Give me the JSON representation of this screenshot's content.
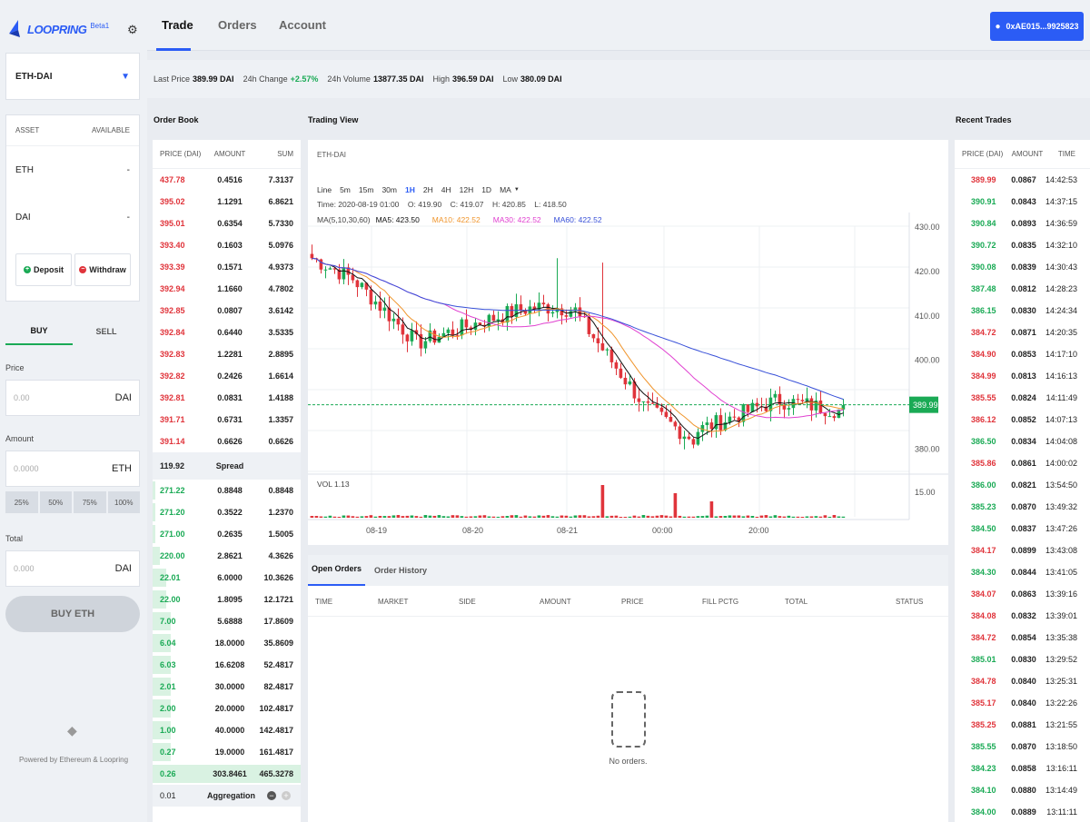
{
  "app": {
    "name": "LOOPRING",
    "badge": "Beta1"
  },
  "sidebar": {
    "market": "ETH-DAI",
    "asset_header": {
      "asset": "ASSET",
      "available": "AVAILABLE"
    },
    "assets": [
      {
        "name": "ETH",
        "value": "-"
      },
      {
        "name": "DAI",
        "value": "-"
      }
    ],
    "deposit_label": "Deposit",
    "withdraw_label": "Withdraw",
    "buy_tab": "BUY",
    "sell_tab": "SELL",
    "price_label": "Price",
    "price_placeholder": "0.00",
    "price_unit": "DAI",
    "amount_label": "Amount",
    "amount_placeholder": "0.0000",
    "amount_unit": "ETH",
    "pcts": [
      "25%",
      "50%",
      "75%",
      "100%"
    ],
    "total_label": "Total",
    "total_placeholder": "0.000",
    "total_unit": "DAI",
    "buy_button": "BUY ETH",
    "powered": "Powered by Ethereum & Loopring"
  },
  "nav": {
    "tabs": [
      "Trade",
      "Orders",
      "Account"
    ],
    "wallet": "0xAE015...9925823"
  },
  "stats": {
    "last_price_label": "Last Price",
    "last_price": "389.99 DAI",
    "change_label": "24h Change",
    "change": "+2.57%",
    "volume_label": "24h Volume",
    "volume": "13877.35 DAI",
    "high_label": "High",
    "high": "396.59 DAI",
    "low_label": "Low",
    "low": "380.09 DAI"
  },
  "orderbook": {
    "title": "Order Book",
    "headers": [
      "PRICE (DAI)",
      "AMOUNT",
      "SUM"
    ],
    "asks": [
      [
        "437.78",
        "0.4516",
        "7.3137"
      ],
      [
        "395.02",
        "1.1291",
        "6.8621"
      ],
      [
        "395.01",
        "0.6354",
        "5.7330"
      ],
      [
        "393.40",
        "0.1603",
        "5.0976"
      ],
      [
        "393.39",
        "0.1571",
        "4.9373"
      ],
      [
        "392.94",
        "1.1660",
        "4.7802"
      ],
      [
        "392.85",
        "0.0807",
        "3.6142"
      ],
      [
        "392.84",
        "0.6440",
        "3.5335"
      ],
      [
        "392.83",
        "1.2281",
        "2.8895"
      ],
      [
        "392.82",
        "0.2426",
        "1.6614"
      ],
      [
        "392.81",
        "0.0831",
        "1.4188"
      ],
      [
        "391.71",
        "0.6731",
        "1.3357"
      ],
      [
        "391.14",
        "0.6626",
        "0.6626"
      ]
    ],
    "spread_value": "119.92",
    "spread_label": "Spread",
    "bids": [
      [
        "271.22",
        "0.8848",
        "0.8848",
        0.02
      ],
      [
        "271.20",
        "0.3522",
        "1.2370",
        0.02
      ],
      [
        "271.00",
        "0.2635",
        "1.5005",
        0.02
      ],
      [
        "220.00",
        "2.8621",
        "4.3626",
        0.05
      ],
      [
        "22.01",
        "6.0000",
        "10.3626",
        0.09
      ],
      [
        "22.00",
        "1.8095",
        "12.1721",
        0.09
      ],
      [
        "7.00",
        "5.6888",
        "17.8609",
        0.12
      ],
      [
        "6.04",
        "18.0000",
        "35.8609",
        0.12
      ],
      [
        "6.03",
        "16.6208",
        "52.4817",
        0.12
      ],
      [
        "2.01",
        "30.0000",
        "82.4817",
        0.12
      ],
      [
        "2.00",
        "20.0000",
        "102.4817",
        0.12
      ],
      [
        "1.00",
        "40.0000",
        "142.4817",
        0.12
      ],
      [
        "0.27",
        "19.0000",
        "161.4817",
        0.12
      ],
      [
        "0.26",
        "303.8461",
        "465.3278",
        1.0
      ]
    ],
    "agg_value": "0.01",
    "agg_label": "Aggregation"
  },
  "trading": {
    "title": "Trading View",
    "pair": "ETH-DAI",
    "intervals": [
      "Line",
      "5m",
      "15m",
      "30m",
      "1H",
      "2H",
      "4H",
      "12H",
      "1D",
      "MA"
    ],
    "active_interval": "1H",
    "ohlc": "Time: 2020-08-19 01:00    O: 419.90    C: 419.07    H: 420.85    L: 418.50",
    "ma": {
      "label": "MA(5,10,30,60)",
      "ma5": "MA5: 423.50",
      "ma10": "MA10: 422.52",
      "ma30": "MA30: 422.52",
      "ma60": "MA60: 422.52"
    },
    "price_ticks": [
      "430.00",
      "420.00",
      "410.00",
      "400.00",
      "380.00"
    ],
    "current_price": "389.99",
    "vol_label": "VOL",
    "vol_value": "1.13",
    "vol_tick": "15.00",
    "x_ticks": [
      "08-19",
      "08-20",
      "08-21",
      "00:00",
      "20:00"
    ],
    "colors": {
      "up": "#1aaa55",
      "down": "#e0343b",
      "ma5": "#111111",
      "ma10": "#f0952c",
      "ma30": "#e040d0",
      "ma60": "#3850d8"
    }
  },
  "open_orders": {
    "tabs": [
      "Open Orders",
      "Order History"
    ],
    "headers": [
      "TIME",
      "MARKET",
      "SIDE",
      "AMOUNT",
      "PRICE",
      "FILL PCTG",
      "TOTAL",
      "STATUS"
    ],
    "empty": "No orders."
  },
  "trades": {
    "title": "Recent Trades",
    "headers": [
      "PRICE (DAI)",
      "AMOUNT",
      "TIME"
    ],
    "rows": [
      [
        "389.99",
        "0.0867",
        "14:42:53",
        "down"
      ],
      [
        "390.91",
        "0.0843",
        "14:37:15",
        "up"
      ],
      [
        "390.84",
        "0.0893",
        "14:36:59",
        "up"
      ],
      [
        "390.72",
        "0.0835",
        "14:32:10",
        "up"
      ],
      [
        "390.08",
        "0.0839",
        "14:30:43",
        "up"
      ],
      [
        "387.48",
        "0.0812",
        "14:28:23",
        "up"
      ],
      [
        "386.15",
        "0.0830",
        "14:24:34",
        "up"
      ],
      [
        "384.72",
        "0.0871",
        "14:20:35",
        "down"
      ],
      [
        "384.90",
        "0.0853",
        "14:17:10",
        "down"
      ],
      [
        "384.99",
        "0.0813",
        "14:16:13",
        "down"
      ],
      [
        "385.55",
        "0.0824",
        "14:11:49",
        "down"
      ],
      [
        "386.12",
        "0.0852",
        "14:07:13",
        "down"
      ],
      [
        "386.50",
        "0.0834",
        "14:04:08",
        "up"
      ],
      [
        "385.86",
        "0.0861",
        "14:00:02",
        "down"
      ],
      [
        "386.00",
        "0.0821",
        "13:54:50",
        "up"
      ],
      [
        "385.23",
        "0.0870",
        "13:49:32",
        "up"
      ],
      [
        "384.50",
        "0.0837",
        "13:47:26",
        "up"
      ],
      [
        "384.17",
        "0.0899",
        "13:43:08",
        "down"
      ],
      [
        "384.30",
        "0.0844",
        "13:41:05",
        "up"
      ],
      [
        "384.07",
        "0.0863",
        "13:39:16",
        "down"
      ],
      [
        "384.08",
        "0.0832",
        "13:39:01",
        "down"
      ],
      [
        "384.72",
        "0.0854",
        "13:35:38",
        "down"
      ],
      [
        "385.01",
        "0.0830",
        "13:29:52",
        "up"
      ],
      [
        "384.78",
        "0.0840",
        "13:25:31",
        "down"
      ],
      [
        "385.17",
        "0.0840",
        "13:22:26",
        "down"
      ],
      [
        "385.25",
        "0.0881",
        "13:21:55",
        "down"
      ],
      [
        "385.55",
        "0.0870",
        "13:18:50",
        "up"
      ],
      [
        "384.23",
        "0.0858",
        "13:16:11",
        "up"
      ],
      [
        "384.10",
        "0.0880",
        "13:14:49",
        "up"
      ],
      [
        "384.00",
        "0.0889",
        "13:11:11",
        "up"
      ]
    ]
  }
}
